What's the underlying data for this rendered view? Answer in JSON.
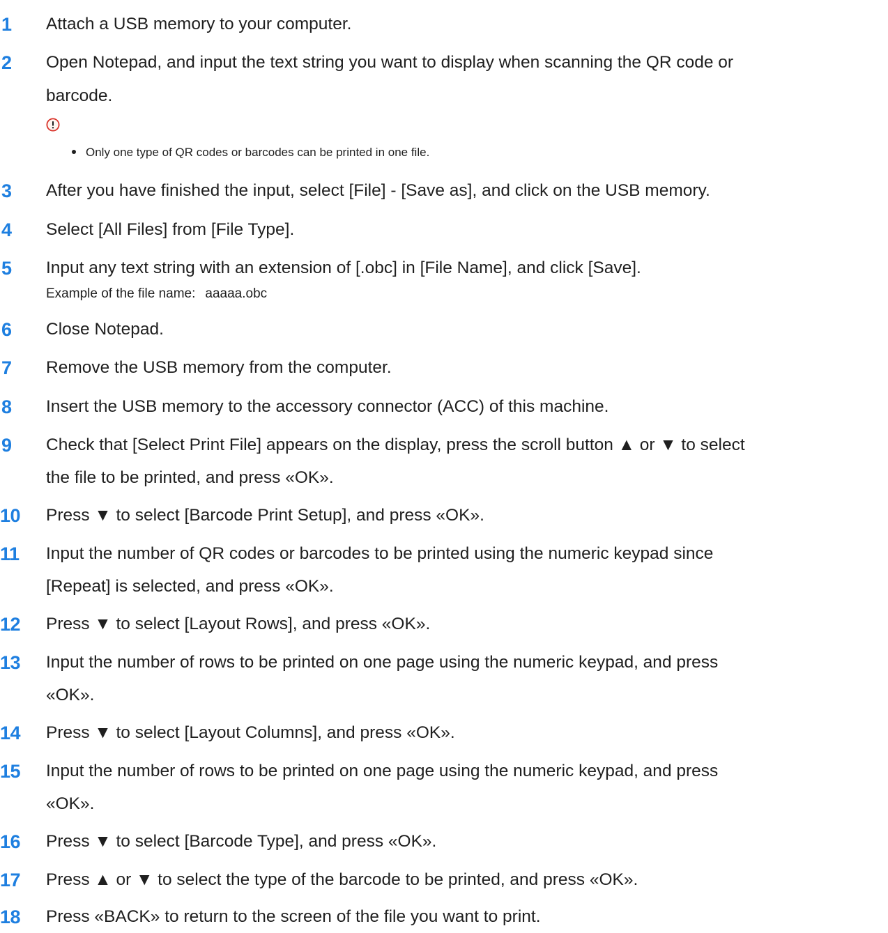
{
  "steps": [
    {
      "num": "1",
      "text": " Attach a USB memory to your computer."
    },
    {
      "num": "2",
      "line1": "Open Notepad, and input the text string you want to display when scanning the QR code or",
      "line2": "barcode."
    },
    {
      "num": "3",
      "text": "After you have finished the input, select [File] - [Save as], and click on the USB memory."
    },
    {
      "num": "4",
      "text": "Select [All Files] from [File Type]."
    },
    {
      "num": "5",
      "text": "Input any text string with an extension of [.obc] in [File Name], and click [Save]."
    },
    {
      "num": "6",
      "text": "Close Notepad."
    },
    {
      "num": "7",
      "text": "Remove the USB memory from the computer."
    },
    {
      "num": "8",
      "text": "Insert the USB memory to the accessory connector (ACC) of this machine."
    },
    {
      "num": "9",
      "line1": "Check that [Select Print File] appears on the display, press the scroll button ▲ or ▼ to select",
      "line2": "the file to be printed, and press «OK»."
    },
    {
      "num": "10",
      "text": "Press ▼ to select [Barcode Print Setup], and press «OK»."
    },
    {
      "num": "11",
      "line1": "Input the number of QR codes or barcodes to be printed using the numeric keypad since",
      "line2": "[Repeat] is selected, and press «OK»."
    },
    {
      "num": "12",
      "text": "Press ▼ to select [Layout Rows], and press «OK»."
    },
    {
      "num": "13",
      "line1": "Input the number of rows to be printed on one page using the numeric keypad, and press",
      "line2": "«OK»."
    },
    {
      "num": "14",
      "text": "Press ▼ to select [Layout Columns], and press «OK»."
    },
    {
      "num": "15",
      "line1": "Input the number of rows to be printed on one page using the numeric keypad, and press",
      "line2": "«OK»."
    },
    {
      "num": "16",
      "text": "Press ▼ to select [Barcode Type], and press «OK»."
    },
    {
      "num": "17",
      "text": "Press ▲ or ▼ to select the type of the barcode to be printed, and press «OK»."
    },
    {
      "num": "18",
      "text": "Press «BACK» to return to the screen of the file you want to print."
    }
  ],
  "note": {
    "icon": "caution-icon",
    "text": "Only one type of QR codes or barcodes can be printed in one file."
  },
  "example": {
    "label": "Example of the file name:",
    "value": "aaaaa.obc"
  },
  "colors": {
    "step_number": "#1e7fe0",
    "note_icon": "#d9342b"
  }
}
